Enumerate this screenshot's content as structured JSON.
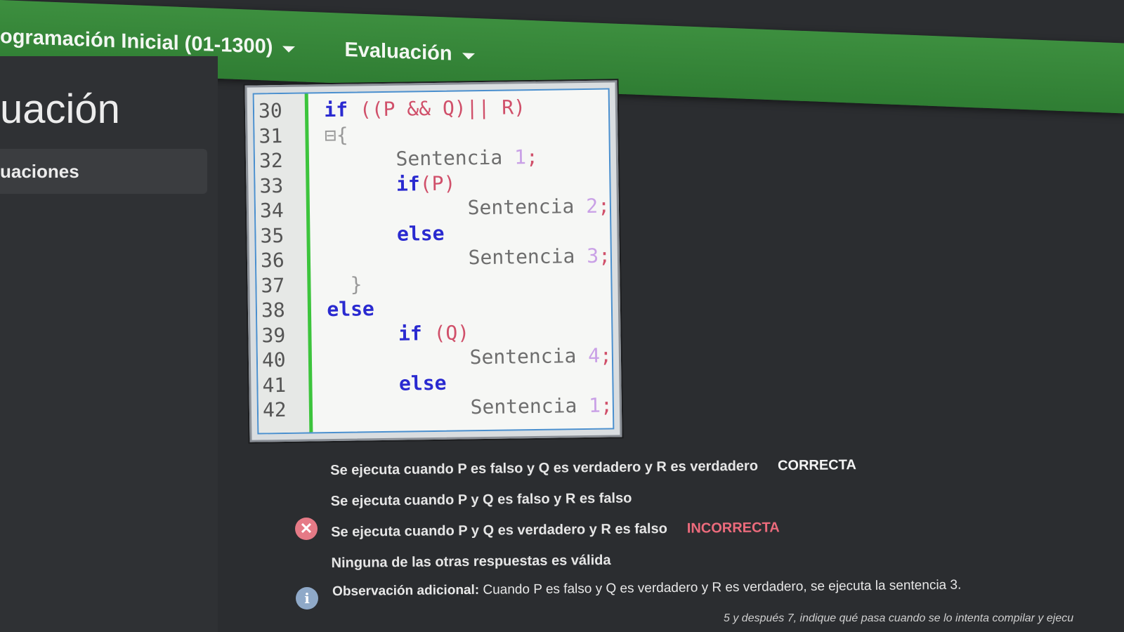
{
  "nav": {
    "course": "ogramación Inicial (01-1300)",
    "section": "Evaluación"
  },
  "page": {
    "title": "uación",
    "sidebar_link": "uaciones"
  },
  "code": {
    "line_numbers": [
      "30",
      "31",
      "32",
      "33",
      "34",
      "35",
      "36",
      "37",
      "38",
      "39",
      "40",
      "41",
      "42"
    ]
  },
  "answers": [
    {
      "text": "Se ejecuta cuando P es falso y Q es verdadero y R es verdadero",
      "tag": "CORRECTA"
    },
    {
      "text": "Se ejecuta cuando P y Q es falso y R es falso",
      "tag": ""
    },
    {
      "text": "Se ejecuta cuando P y Q es verdadero y R es falso",
      "tag": "INCORRECTA"
    },
    {
      "text": "Ninguna de las otras respuestas es válida",
      "tag": ""
    }
  ],
  "observation": {
    "label": "Observación adicional:",
    "text": "Cuando P es falso y Q es verdadero y R es verdadero, se ejecuta la sentencia 3."
  },
  "footer": "5 y después 7, indique qué pasa cuando se lo intenta compilar y ejecu",
  "colors": {
    "topbar": "#3d8f3f",
    "correct": "#f4f4f4",
    "incorrect": "#ec6b7c",
    "gutter_marker": "#3cc43c"
  },
  "icons": [
    "chevron-down-icon",
    "close-icon",
    "info-icon"
  ]
}
